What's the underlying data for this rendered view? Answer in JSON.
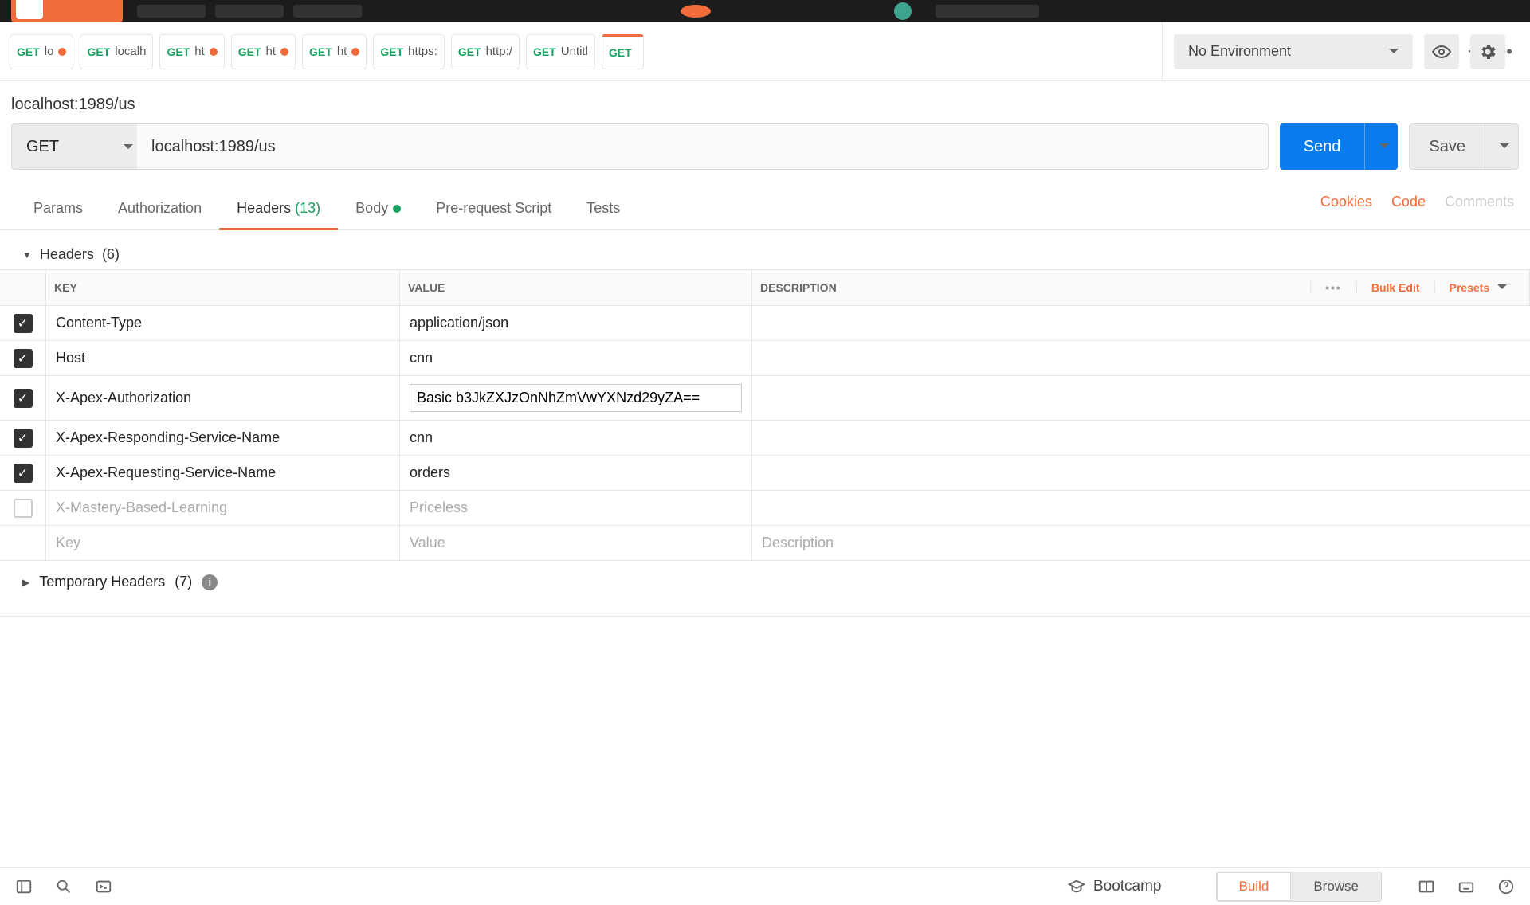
{
  "topbar": {},
  "env": {
    "label": "No Environment"
  },
  "tabs": [
    {
      "method": "GET",
      "label": "lo",
      "dot": true
    },
    {
      "method": "GET",
      "label": "localh",
      "dot": false
    },
    {
      "method": "GET",
      "label": "ht",
      "dot": true
    },
    {
      "method": "GET",
      "label": "ht",
      "dot": true
    },
    {
      "method": "GET",
      "label": "ht",
      "dot": true
    },
    {
      "method": "GET",
      "label": "https:",
      "dot": false
    },
    {
      "method": "GET",
      "label": "http:/",
      "dot": false
    },
    {
      "method": "GET",
      "label": "Untitl",
      "dot": false
    },
    {
      "method": "GET",
      "label": "",
      "dot": false,
      "active": true
    }
  ],
  "request": {
    "title": "localhost:1989/us",
    "method": "GET",
    "url": "localhost:1989/us",
    "send": "Send",
    "save": "Save"
  },
  "content_tabs": {
    "params": "Params",
    "auth": "Authorization",
    "headers_label": "Headers",
    "headers_count": "(13)",
    "body": "Body",
    "prereq": "Pre-request Script",
    "tests": "Tests",
    "cookies": "Cookies",
    "code": "Code",
    "comments": "Comments"
  },
  "headers_section": {
    "label": "Headers",
    "count": "(6)"
  },
  "table": {
    "cols": {
      "key": "KEY",
      "value": "VALUE",
      "desc": "DESCRIPTION"
    },
    "bulk": "Bulk Edit",
    "presets": "Presets",
    "rows": [
      {
        "checked": true,
        "key": "Content-Type",
        "value": "application/json",
        "desc": ""
      },
      {
        "checked": true,
        "key": "Host",
        "value": "cnn",
        "desc": ""
      },
      {
        "checked": true,
        "key": "X-Apex-Authorization",
        "value": "Basic b3JkZXJzOnNhZmVwYXNzd29yZA==",
        "desc": "",
        "editing": true
      },
      {
        "checked": true,
        "key": "X-Apex-Responding-Service-Name",
        "value": "cnn",
        "desc": ""
      },
      {
        "checked": true,
        "key": "X-Apex-Requesting-Service-Name",
        "value": "orders",
        "desc": ""
      },
      {
        "checked": false,
        "key": "X-Mastery-Based-Learning",
        "value": "Priceless",
        "desc": ""
      }
    ],
    "placeholder": {
      "key": "Key",
      "value": "Value",
      "desc": "Description"
    }
  },
  "temp_headers": {
    "label": "Temporary Headers",
    "count": "(7)"
  },
  "bottom": {
    "bootcamp": "Bootcamp",
    "build": "Build",
    "browse": "Browse"
  }
}
